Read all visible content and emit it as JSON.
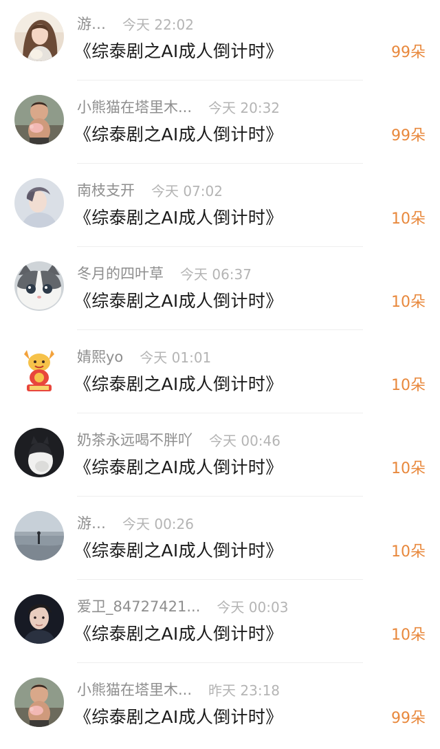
{
  "items": [
    {
      "username": "游…",
      "time": "今天 22:02",
      "title": "《综泰剧之AI成人倒计时》",
      "gift": "99朵",
      "avatar": "woman-photo"
    },
    {
      "username": "小熊猫在塔里木...",
      "time": "今天 20:32",
      "title": "《综泰剧之AI成人倒计时》",
      "gift": "99朵",
      "avatar": "baby-with-piglet-photo"
    },
    {
      "username": "南枝支开",
      "time": "今天 07:02",
      "title": "《综泰剧之AI成人倒计时》",
      "gift": "10朵",
      "avatar": "young-man-photo"
    },
    {
      "username": "冬月的四叶草",
      "time": "今天 06:37",
      "title": "《综泰剧之AI成人倒计时》",
      "gift": "10朵",
      "avatar": "cat-photo"
    },
    {
      "username": "婧熙yo",
      "time": "今天 01:01",
      "title": "《综泰剧之AI成人倒计时》",
      "gift": "10朵",
      "avatar": "cartoon-dragon"
    },
    {
      "username": "奶茶永远喝不胖吖",
      "time": "今天 00:46",
      "title": "《综泰剧之AI成人倒计时》",
      "gift": "10朵",
      "avatar": "black-white-cat-photo"
    },
    {
      "username": "游…",
      "time": "今天 00:26",
      "title": "《综泰剧之AI成人倒计时》",
      "gift": "10朵",
      "avatar": "beach-silhouette-photo"
    },
    {
      "username": "爱卫_84727421...",
      "time": "今天 00:03",
      "title": "《综泰剧之AI成人倒计时》",
      "gift": "10朵",
      "avatar": "man-portrait-photo"
    },
    {
      "username": "小熊猫在塔里木...",
      "time": "昨天 23:18",
      "title": "《综泰剧之AI成人倒计时》",
      "gift": "99朵",
      "avatar": "baby-with-piglet-photo"
    }
  ],
  "colors": {
    "username": "#8e8e8e",
    "time": "#b4b4b4",
    "title": "#1a1a1a",
    "gift": "#e8883c",
    "divider": "#eeeeee"
  }
}
